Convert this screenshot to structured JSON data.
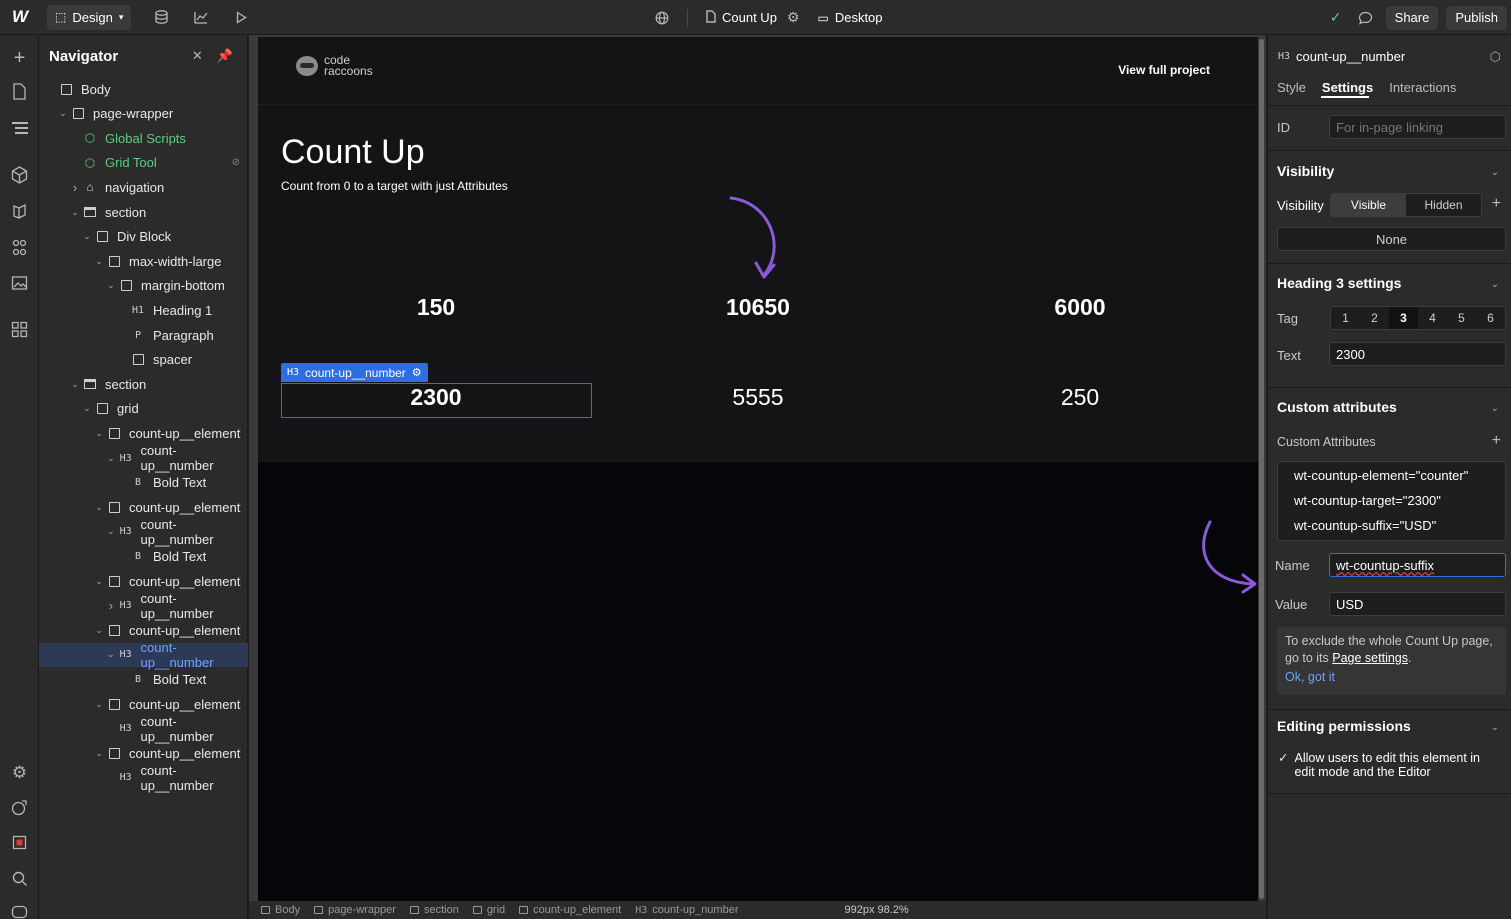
{
  "topbar": {
    "logo": "W",
    "mode_label": "Design",
    "page_name": "Count Up",
    "breakpoint_label": "Desktop",
    "share_label": "Share",
    "publish_label": "Publish"
  },
  "navigator": {
    "title": "Navigator",
    "items": [
      {
        "label": "Body",
        "depth": 0,
        "icon": "box"
      },
      {
        "label": "page-wrapper",
        "depth": 1,
        "icon": "box",
        "caret": "down"
      },
      {
        "label": "Global Scripts",
        "depth": 2,
        "icon": "component",
        "green": true
      },
      {
        "label": "Grid Tool",
        "depth": 2,
        "icon": "component",
        "green": true
      },
      {
        "label": "navigation",
        "depth": 2,
        "icon": "home",
        "caret": "right"
      },
      {
        "label": "section",
        "depth": 2,
        "icon": "section",
        "caret": "down"
      },
      {
        "label": "Div Block",
        "depth": 3,
        "icon": "box",
        "caret": "down"
      },
      {
        "label": "max-width-large",
        "depth": 4,
        "icon": "box",
        "caret": "down"
      },
      {
        "label": "margin-bottom",
        "depth": 5,
        "icon": "box",
        "caret": "down"
      },
      {
        "label": "Heading 1",
        "depth": 6,
        "icon": "H1"
      },
      {
        "label": "Paragraph",
        "depth": 6,
        "icon": "P"
      },
      {
        "label": "spacer",
        "depth": 6,
        "icon": "box"
      },
      {
        "label": "section",
        "depth": 2,
        "icon": "section",
        "caret": "down"
      },
      {
        "label": "grid",
        "depth": 3,
        "icon": "box",
        "caret": "down"
      },
      {
        "label": "count-up__element",
        "depth": 4,
        "icon": "box",
        "caret": "down"
      },
      {
        "label": "count-up__number",
        "depth": 5,
        "icon": "H3",
        "caret": "down"
      },
      {
        "label": "Bold Text",
        "depth": 6,
        "icon": "B"
      },
      {
        "label": "count-up__element",
        "depth": 4,
        "icon": "box",
        "caret": "down"
      },
      {
        "label": "count-up__number",
        "depth": 5,
        "icon": "H3",
        "caret": "down"
      },
      {
        "label": "Bold Text",
        "depth": 6,
        "icon": "B"
      },
      {
        "label": "count-up__element",
        "depth": 4,
        "icon": "box",
        "caret": "down"
      },
      {
        "label": "count-up__number",
        "depth": 5,
        "icon": "H3",
        "caret": "right"
      },
      {
        "label": "count-up__element",
        "depth": 4,
        "icon": "box",
        "caret": "down"
      },
      {
        "label": "count-up__number",
        "depth": 5,
        "icon": "H3",
        "caret": "down",
        "selected": true
      },
      {
        "label": "Bold Text",
        "depth": 6,
        "icon": "B"
      },
      {
        "label": "count-up__element",
        "depth": 4,
        "icon": "box",
        "caret": "down"
      },
      {
        "label": "count-up__number",
        "depth": 5,
        "icon": "H3"
      },
      {
        "label": "count-up__element",
        "depth": 4,
        "icon": "box",
        "caret": "down"
      },
      {
        "label": "count-up__number",
        "depth": 5,
        "icon": "H3"
      }
    ]
  },
  "canvas": {
    "logo_text_1": "code",
    "logo_text_2": "raccoons",
    "view_full": "View full project",
    "heading": "Count Up",
    "subheading": "Count from 0 to a target with just Attributes",
    "numbers": [
      "150",
      "10650",
      "6000",
      "2300",
      "5555",
      "250"
    ],
    "selection_label": "count-up__number",
    "selection_tag": "H3"
  },
  "breadcrumb": [
    "Body",
    "page-wrapper",
    "section",
    "grid",
    "count-up_element",
    "count-up_number"
  ],
  "breadcrumb_right": "992px 98.2%",
  "panel": {
    "element_tag": "H3",
    "element_name": "count-up__number",
    "tabs": [
      "Style",
      "Settings",
      "Interactions"
    ],
    "active_tab": "Settings",
    "id_label": "ID",
    "id_placeholder": "For in-page linking",
    "visibility_title": "Visibility",
    "visibility_label": "Visibility",
    "visibility_options": [
      "Visible",
      "Hidden"
    ],
    "visibility_none": "None",
    "heading_settings_title": "Heading 3 settings",
    "tag_label": "Tag",
    "tag_options": [
      "1",
      "2",
      "3",
      "4",
      "5",
      "6"
    ],
    "text_label": "Text",
    "text_value": "2300",
    "custom_attrs_title": "Custom attributes",
    "custom_attrs_label": "Custom Attributes",
    "attributes": [
      "wt-countup-element=\"counter\"",
      "wt-countup-target=\"2300\"",
      "wt-countup-suffix=\"USD\""
    ],
    "name_label": "Name",
    "name_value": "wt-countup-suffix",
    "value_label": "Value",
    "value_value": "USD",
    "notice_text": "To exclude the whole Count Up page, go to its",
    "notice_link": "Page settings",
    "notice_ok": "Ok, got it",
    "editing_title": "Editing permissions",
    "editing_checkbox": "Allow users to edit this element in edit mode and the Editor"
  }
}
